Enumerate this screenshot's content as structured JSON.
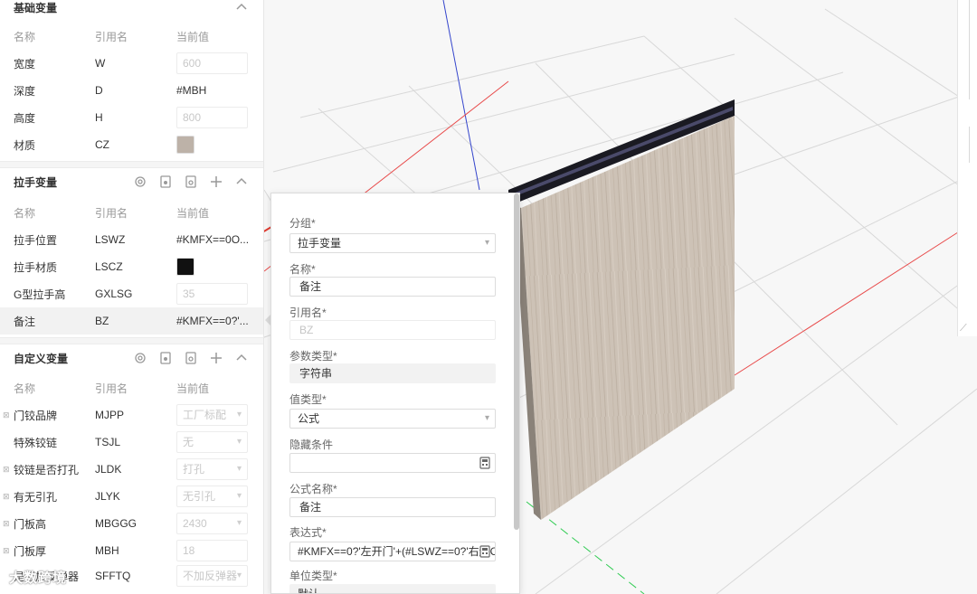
{
  "basic_section": {
    "title": "基础变量",
    "headers": {
      "name": "名称",
      "ref": "引用名",
      "value": "当前值"
    },
    "rows": [
      {
        "name": "宽度",
        "ref": "W",
        "value": "600"
      },
      {
        "name": "深度",
        "ref": "D",
        "value": "#MBH"
      },
      {
        "name": "高度",
        "ref": "H",
        "value": "800"
      },
      {
        "name": "材质",
        "ref": "CZ",
        "value": ""
      }
    ],
    "material_color": "#bdb2a8"
  },
  "handle_section": {
    "title": "拉手变量",
    "headers": {
      "name": "名称",
      "ref": "引用名",
      "value": "当前值"
    },
    "rows": [
      {
        "name": "拉手位置",
        "ref": "LSWZ",
        "value": "#KMFX==0O..."
      },
      {
        "name": "拉手材质",
        "ref": "LSCZ",
        "value": ""
      },
      {
        "name": "G型拉手高",
        "ref": "GXLSG",
        "value": "35"
      },
      {
        "name": "备注",
        "ref": "BZ",
        "value": "#KMFX==0?'..."
      }
    ],
    "material_color": "#111111"
  },
  "custom_section": {
    "title": "自定义变量",
    "headers": {
      "name": "名称",
      "ref": "引用名",
      "value": "当前值"
    },
    "rows": [
      {
        "name": "门铰品牌",
        "ref": "MJPP",
        "value": "工厂标配"
      },
      {
        "name": "特殊铰链",
        "ref": "TSJL",
        "value": "无"
      },
      {
        "name": "铰链是否打孔",
        "ref": "JLDK",
        "value": "打孔"
      },
      {
        "name": "有无引孔",
        "ref": "JLYK",
        "value": "无引孔"
      },
      {
        "name": "门板高",
        "ref": "MBGGG",
        "value": "2430"
      },
      {
        "name": "门板厚",
        "ref": "MBH",
        "value": "18"
      },
      {
        "name": "是否加反弹器",
        "ref": "SFFTQ",
        "value": "不加反弹器"
      }
    ]
  },
  "form": {
    "group_label": "分组*",
    "group_value": "拉手变量",
    "name_label": "名称*",
    "name_value": "备注",
    "ref_label": "引用名*",
    "ref_value": "BZ",
    "param_type_label": "参数类型*",
    "param_type_value": "字符串",
    "value_type_label": "值类型*",
    "value_type_value": "公式",
    "hidden_cond_label": "隐藏条件",
    "hidden_cond_value": "",
    "formula_name_label": "公式名称*",
    "formula_name_value": "备注",
    "expression_label": "表达式*",
    "expression_value": "#KMFX==0?'左开门'+(#LSWZ==0?'右边C",
    "unit_type_label": "单位类型*",
    "unit_type_value": "默认"
  },
  "watermark": "大数跨境",
  "colors": {
    "panel_wood": "#cbbfb2",
    "arrow": "#e03c31",
    "axis_blue": "#3344cc",
    "axis_red": "#e84a4a",
    "axis_green": "#33cc55"
  }
}
